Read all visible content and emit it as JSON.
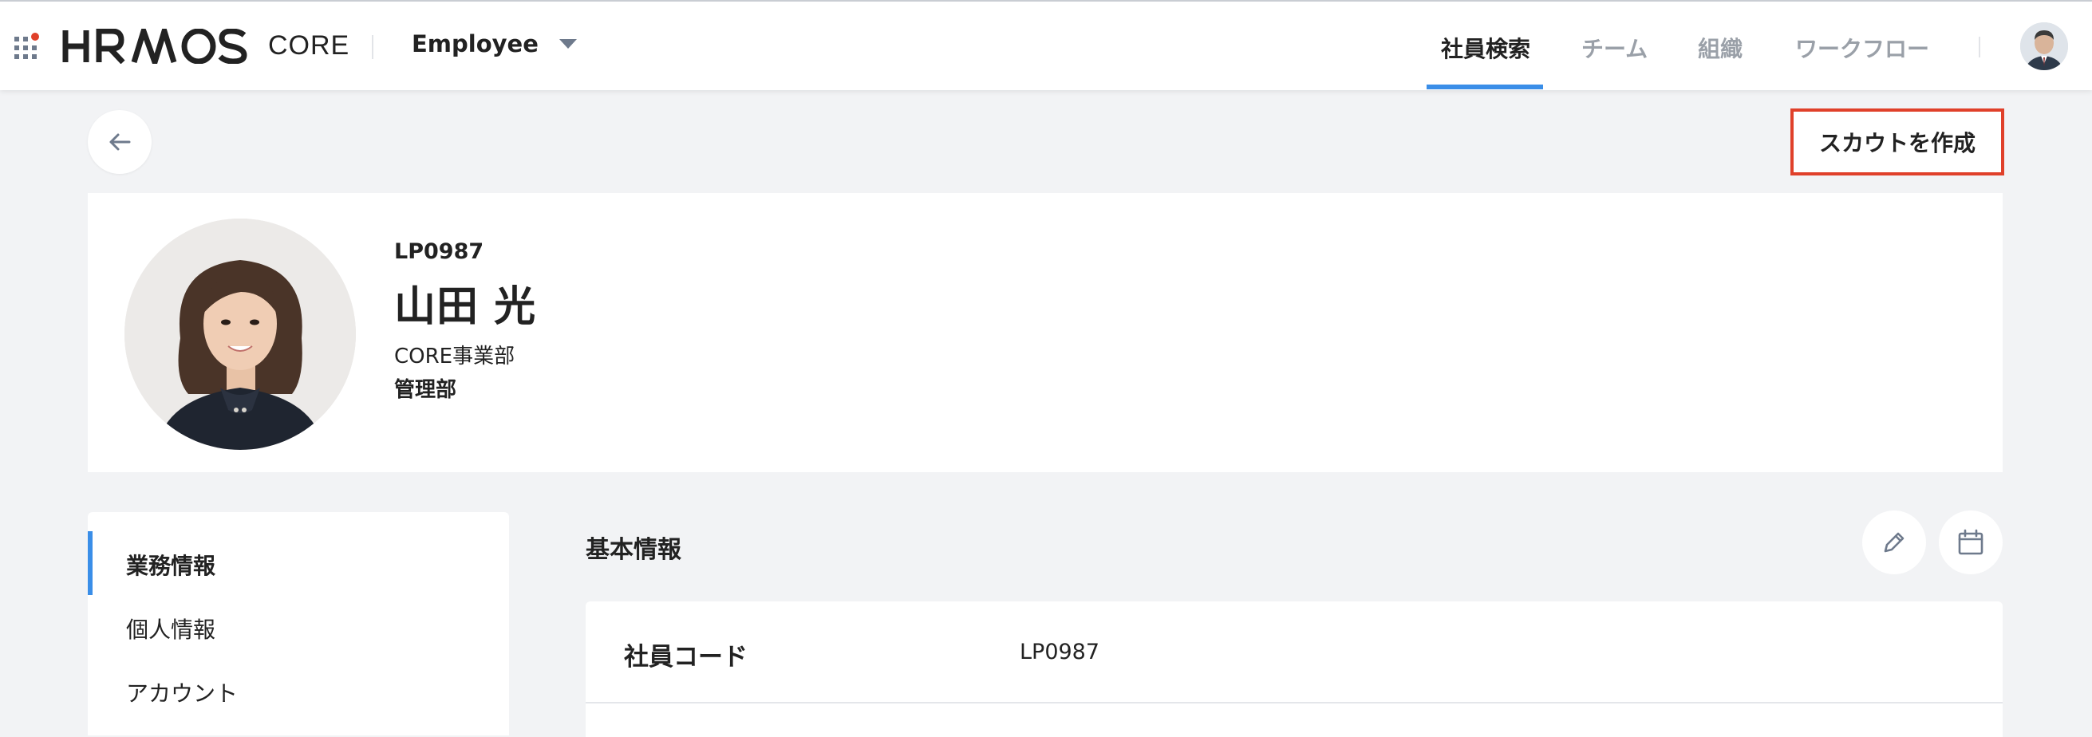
{
  "header": {
    "apps_icon": "apps-grid-icon",
    "logo_text": "HRMOS",
    "product": "CORE",
    "context": "Employee",
    "nav": [
      {
        "label": "社員検索",
        "active": true
      },
      {
        "label": "チーム",
        "active": false
      },
      {
        "label": "組織",
        "active": false
      },
      {
        "label": "ワークフロー",
        "active": false
      }
    ],
    "accent_color": "#3a8ee8"
  },
  "actions": {
    "back_icon": "arrow-left-icon",
    "scout_label": "スカウトを作成",
    "scout_border_color": "#e0402a"
  },
  "profile": {
    "code": "LP0987",
    "name": "山田 光",
    "division": "CORE事業部",
    "department": "管理部"
  },
  "side_menu": {
    "items": [
      {
        "label": "業務情報",
        "active": true
      },
      {
        "label": "個人情報",
        "active": false
      },
      {
        "label": "アカウント",
        "active": false
      }
    ]
  },
  "section": {
    "title": "基本情報",
    "edit_icon": "pencil-icon",
    "history_icon": "calendar-icon"
  },
  "info_rows": [
    {
      "label": "社員コード",
      "value": "LP0987"
    }
  ]
}
